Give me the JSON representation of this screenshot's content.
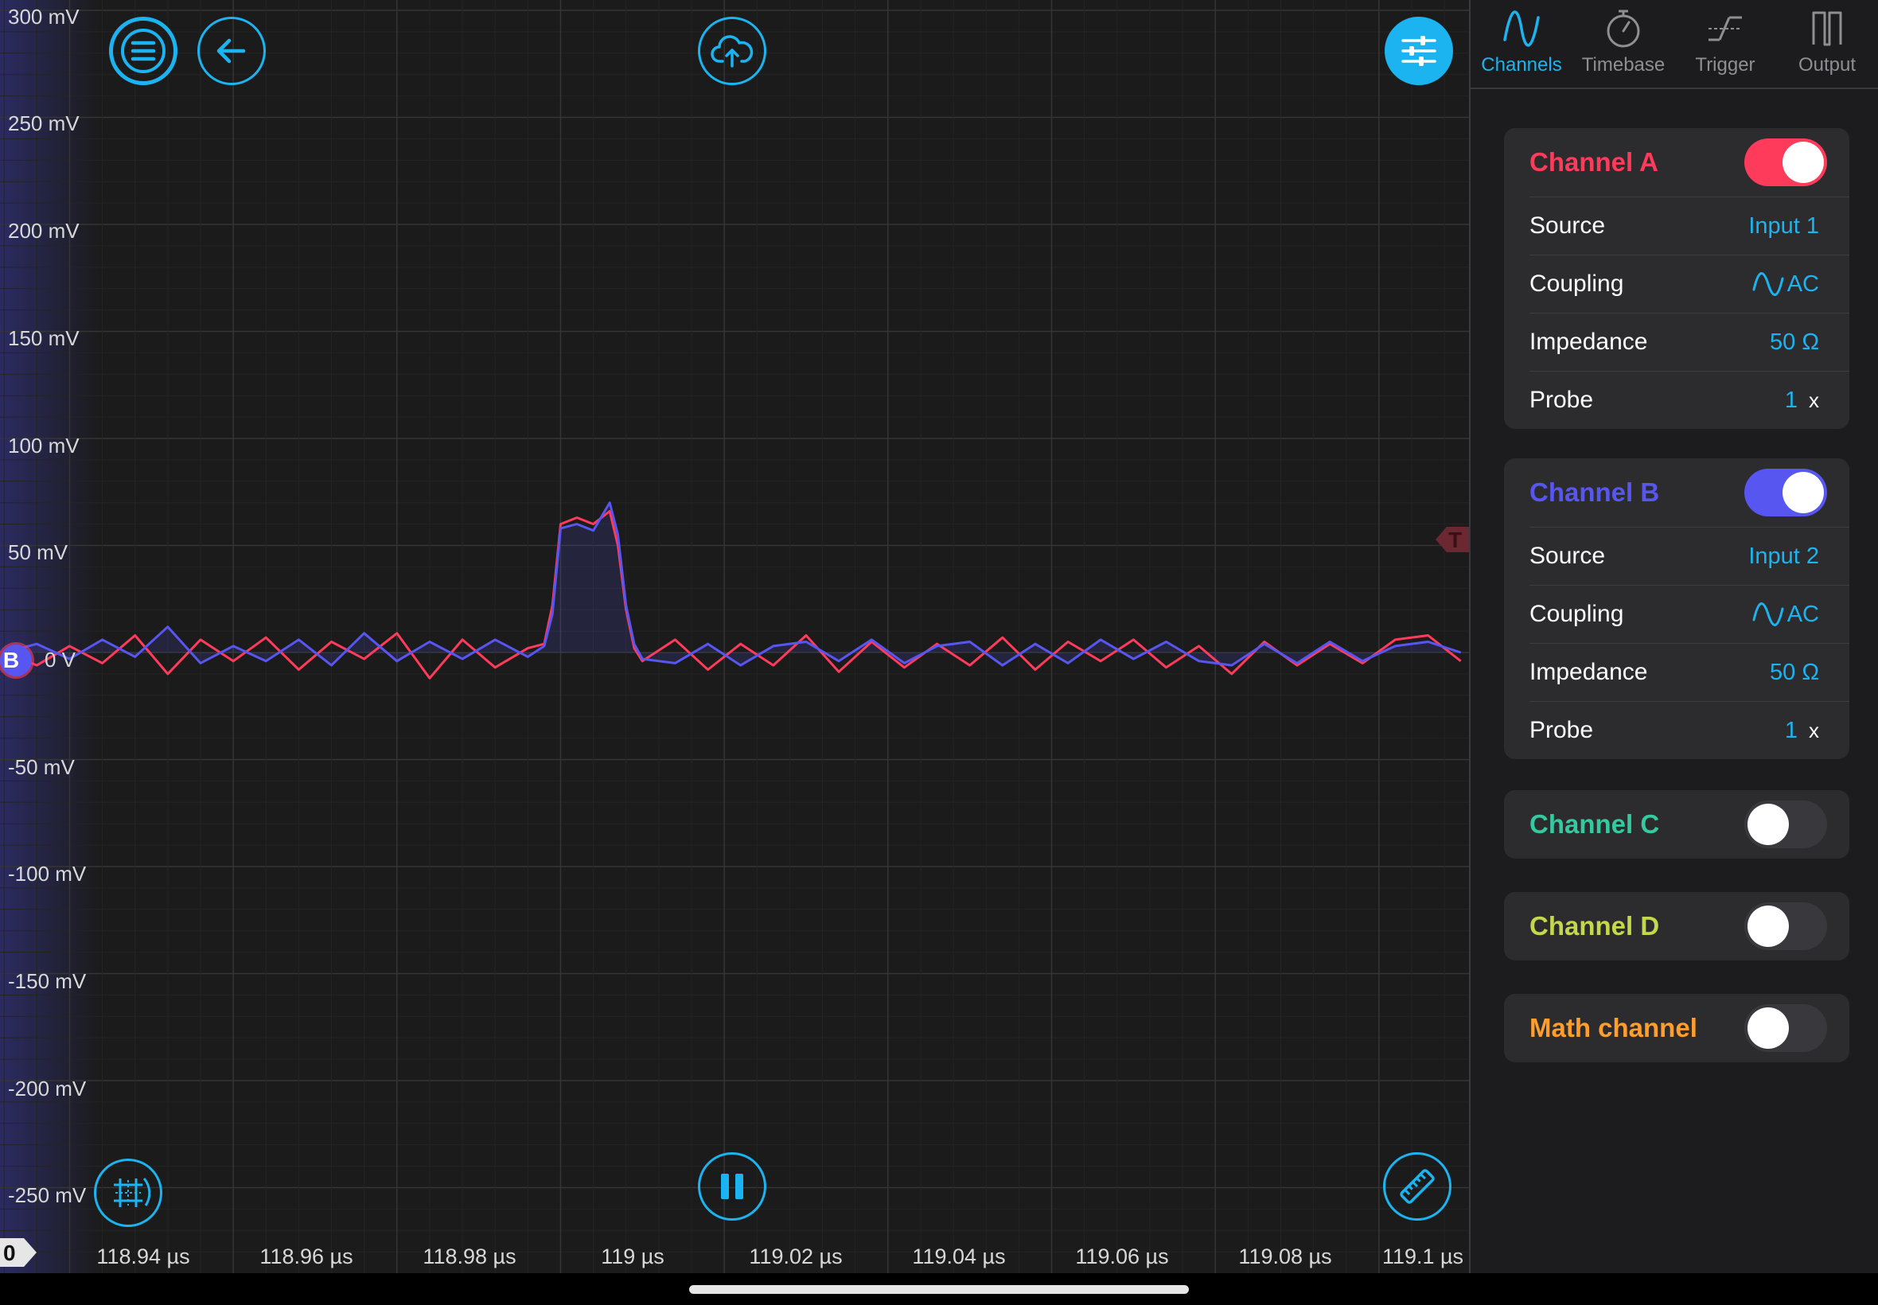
{
  "colors": {
    "accent": "#1cb4f0",
    "channel_a": "#ff3b5c",
    "channel_b": "#5856f0",
    "channel_c": "#35c9a0",
    "channel_d": "#c3d84a",
    "math": "#ff9e2c"
  },
  "toolbar": {
    "menu_icon": "hamburger-icon",
    "back_icon": "arrow-left-icon",
    "upload_icon": "cloud-upload-icon",
    "settings_icon": "sliders-icon",
    "grid_icon": "grid-cursor-icon",
    "pause_icon": "pause-icon",
    "measure_icon": "ruler-icon"
  },
  "scope": {
    "y_axis_labels": [
      "300 mV",
      "250 mV",
      "200 mV",
      "150 mV",
      "100 mV",
      "50 mV",
      "0 V",
      "-50 mV",
      "-100 mV",
      "-150 mV",
      "-200 mV",
      "-250 mV"
    ],
    "x_axis_labels": [
      "118.94 µs",
      "118.96 µs",
      "118.98 µs",
      "119 µs",
      "119.02 µs",
      "119.04 µs",
      "119.06 µs",
      "119.08 µs",
      "119.1 µs"
    ],
    "channel_b_marker": "B",
    "trigger_marker": "T",
    "zero_marker": "0"
  },
  "chart_data": {
    "type": "line",
    "xlabel": "",
    "ylabel": "",
    "xlim": [
      118.9315,
      119.111
    ],
    "ylim": [
      -300,
      300
    ],
    "grid": true,
    "series": [
      {
        "name": "Channel A",
        "x": [
          118.932,
          118.936,
          118.94,
          118.944,
          118.948,
          118.952,
          118.956,
          118.96,
          118.964,
          118.968,
          118.972,
          118.976,
          118.98,
          118.984,
          118.988,
          118.992,
          118.996,
          118.998,
          118.999,
          119.0,
          119.002,
          119.004,
          119.006,
          119.007,
          119.008,
          119.009,
          119.01,
          119.014,
          119.018,
          119.022,
          119.026,
          119.03,
          119.034,
          119.038,
          119.042,
          119.046,
          119.05,
          119.054,
          119.058,
          119.062,
          119.066,
          119.07,
          119.074,
          119.078,
          119.082,
          119.086,
          119.09,
          119.094,
          119.098,
          119.102,
          119.106,
          119.11
        ],
        "values": [
          0,
          -6,
          3,
          -5,
          8,
          -10,
          6,
          -4,
          7,
          -8,
          5,
          -3,
          9,
          -12,
          6,
          -7,
          2,
          4,
          22,
          60,
          63,
          60,
          66,
          50,
          20,
          2,
          -4,
          6,
          -8,
          4,
          -6,
          8,
          -9,
          5,
          -7,
          4,
          -6,
          7,
          -8,
          5,
          -4,
          6,
          -7,
          3,
          -10,
          5,
          -6,
          4,
          -5,
          6,
          8,
          -4
        ]
      },
      {
        "name": "Channel B",
        "x": [
          118.932,
          118.936,
          118.94,
          118.944,
          118.948,
          118.952,
          118.956,
          118.96,
          118.964,
          118.968,
          118.972,
          118.976,
          118.98,
          118.984,
          118.988,
          118.992,
          118.996,
          118.998,
          118.999,
          119.0,
          119.002,
          119.004,
          119.006,
          119.007,
          119.008,
          119.009,
          119.01,
          119.014,
          119.018,
          119.022,
          119.026,
          119.03,
          119.034,
          119.038,
          119.042,
          119.046,
          119.05,
          119.054,
          119.058,
          119.062,
          119.066,
          119.07,
          119.074,
          119.078,
          119.082,
          119.086,
          119.09,
          119.094,
          119.098,
          119.102,
          119.106,
          119.11
        ],
        "values": [
          0,
          4,
          -3,
          6,
          -2,
          12,
          -5,
          3,
          -4,
          6,
          -6,
          9,
          -4,
          5,
          -3,
          6,
          -2,
          3,
          18,
          58,
          60,
          57,
          70,
          55,
          22,
          4,
          -3,
          -5,
          4,
          -6,
          3,
          5,
          -4,
          6,
          -5,
          3,
          5,
          -6,
          4,
          -5,
          6,
          -3,
          5,
          -4,
          -6,
          4,
          -5,
          5,
          -4,
          3,
          5,
          0
        ]
      }
    ]
  },
  "panel": {
    "tabs": [
      {
        "label": "Channels",
        "icon": "sine-wave-icon"
      },
      {
        "label": "Timebase",
        "icon": "stopwatch-icon"
      },
      {
        "label": "Trigger",
        "icon": "trigger-edge-icon"
      },
      {
        "label": "Output",
        "icon": "square-wave-icon"
      }
    ],
    "channel_a": {
      "title": "Channel A",
      "enabled": true,
      "source_label": "Source",
      "source_value": "Input 1",
      "coupling_label": "Coupling",
      "coupling_value": "AC",
      "impedance_label": "Impedance",
      "impedance_value": "50 Ω",
      "probe_label": "Probe",
      "probe_value": "1",
      "probe_suffix": "x"
    },
    "channel_b": {
      "title": "Channel B",
      "enabled": true,
      "source_label": "Source",
      "source_value": "Input 2",
      "coupling_label": "Coupling",
      "coupling_value": "AC",
      "impedance_label": "Impedance",
      "impedance_value": "50 Ω",
      "probe_label": "Probe",
      "probe_value": "1",
      "probe_suffix": "x"
    },
    "channel_c": {
      "title": "Channel C",
      "enabled": false
    },
    "channel_d": {
      "title": "Channel D",
      "enabled": false
    },
    "math": {
      "title": "Math channel",
      "enabled": false
    }
  }
}
